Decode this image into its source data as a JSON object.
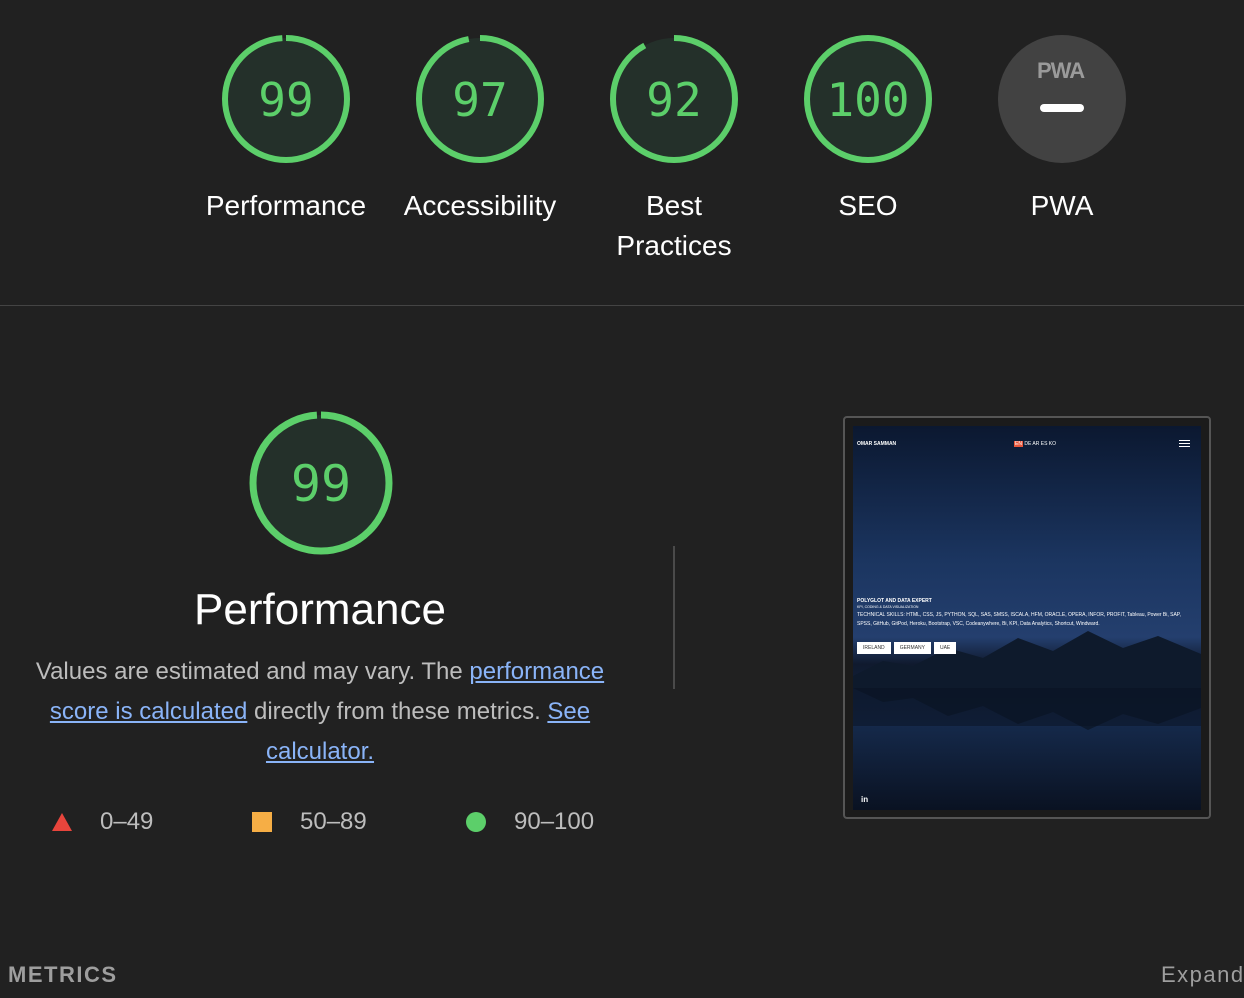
{
  "gauges": [
    {
      "score": "99",
      "label": "Performance"
    },
    {
      "score": "97",
      "label": "Accessibility"
    },
    {
      "score": "92",
      "label": "Best Practices"
    },
    {
      "score": "100",
      "label": "SEO"
    }
  ],
  "pwa": {
    "badge": "PWA",
    "label": "PWA"
  },
  "performance": {
    "score": "99",
    "title": "Performance",
    "desc_prefix": "Values are estimated and may vary. The ",
    "desc_link1": "performance score is calculated",
    "desc_middle": " directly from these metrics. ",
    "desc_link2": "See calculator."
  },
  "legend": [
    {
      "range": "0–49",
      "color": "#e8453c"
    },
    {
      "range": "50–89",
      "color": "#f6ae45"
    },
    {
      "range": "90–100",
      "color": "#5ccf6a"
    }
  ],
  "colors": {
    "good": "#5ccf6a",
    "good_bg": "#24302a",
    "pwa_bg": "#424242"
  },
  "screenshot": {
    "name": "OMAR SAMMAN",
    "lang_active": "EN",
    "lang_rest": " DE AR ES KO",
    "heading": "POLYGLOT AND DATA EXPERT",
    "subheading": "KPI, CODING & DATA VISUALIZATION",
    "skills": "TECHNICAL SKILLS: HTML, CSS, JS, PYTHON, SQL, SAS, SMSS, ISCALA, HFM, ORACLE, OPERA, INFOR, PROFIT, Tableau, Power Bi, SAP, SPSS, GitHub, GitPod, Heroku, Bootstrap, VSC, Codeanywhere, Bi, KPI, Data Analytics, Shortcut, Windward.",
    "buttons": [
      "IRELAND",
      "GERMANY",
      "UAE"
    ],
    "social": "in"
  },
  "footer": {
    "metrics": "METRICS",
    "expand": "Expand view"
  }
}
